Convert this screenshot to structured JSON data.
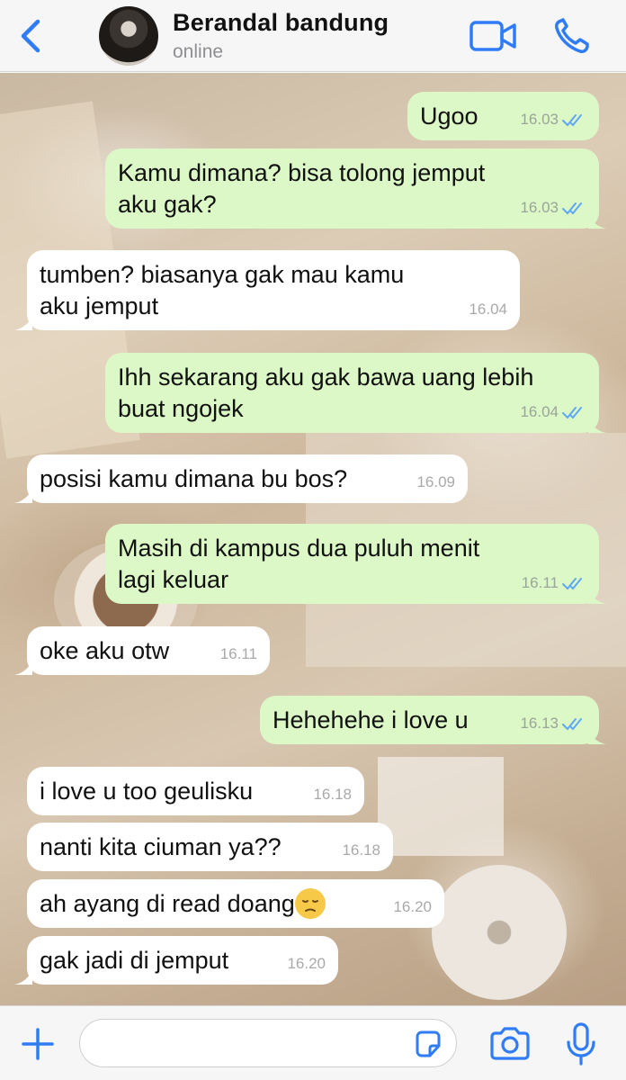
{
  "header": {
    "contact_name": "Berandal bandung",
    "status": "online"
  },
  "messages": [
    {
      "side": "out",
      "text": "Ugoo",
      "time": "16.03",
      "read": true
    },
    {
      "side": "out",
      "text": "Kamu dimana? bisa tolong jemput\naku gak?",
      "time": "16.03",
      "read": true
    },
    {
      "side": "in",
      "text": "tumben? biasanya gak mau kamu\naku jemput",
      "time": "16.04"
    },
    {
      "side": "out",
      "text": "Ihh sekarang aku gak bawa uang lebih\nbuat ngojek",
      "time": "16.04",
      "read": true
    },
    {
      "side": "in",
      "text": "posisi kamu dimana bu bos?",
      "time": "16.09"
    },
    {
      "side": "out",
      "text": "Masih di kampus dua puluh menit\nlagi keluar",
      "time": "16.11",
      "read": true
    },
    {
      "side": "in",
      "text": "oke aku otw",
      "time": "16.11"
    },
    {
      "side": "out",
      "text": "Hehehehe i love u",
      "time": "16.13",
      "read": true
    },
    {
      "side": "in",
      "text": "i love u too geulisku",
      "time": "16.18"
    },
    {
      "side": "in",
      "text": "nanti kita ciuman ya??",
      "time": "16.18"
    },
    {
      "side": "in",
      "text": "ah ayang di read doang",
      "emoji": "pensive-face",
      "time": "16.20"
    },
    {
      "side": "in",
      "text": "gak jadi di jemput",
      "time": "16.20"
    }
  ],
  "composer": {
    "value": "",
    "placeholder": ""
  },
  "colors": {
    "accent": "#2f7cf6",
    "outgoing_bubble": "#dcf8c6",
    "incoming_bubble": "#ffffff",
    "read_ticks": "#5fa8f5"
  },
  "icons": [
    "back-chevron-icon",
    "video-call-icon",
    "phone-icon",
    "plus-icon",
    "sticker-icon",
    "camera-icon",
    "microphone-icon",
    "double-check-icon",
    "pensive-face-emoji"
  ]
}
